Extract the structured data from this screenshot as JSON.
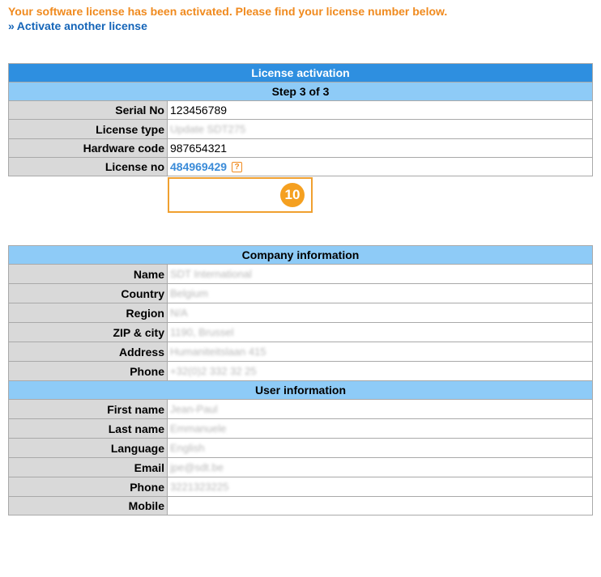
{
  "message": {
    "success": "Your software license has been activated. Please find your license number below.",
    "link_prefix": "»",
    "link_label": "Activate another license"
  },
  "license": {
    "title": "License activation",
    "step": "Step 3 of 3",
    "rows": [
      {
        "label": "Serial No",
        "value": "123456789"
      },
      {
        "label": "License type",
        "value": "Update SDT275"
      },
      {
        "label": "Hardware code",
        "value": "987654321"
      },
      {
        "label": "License no",
        "value": "484969429"
      }
    ],
    "help_icon": "?",
    "callout_number": "10"
  },
  "company": {
    "header": "Company information",
    "rows": [
      {
        "label": "Name",
        "value": "SDT International"
      },
      {
        "label": "Country",
        "value": "Belgium"
      },
      {
        "label": "Region",
        "value": "N/A"
      },
      {
        "label": "ZIP & city",
        "value": "1190, Brussel"
      },
      {
        "label": "Address",
        "value": "Humaniteitslaan 415"
      },
      {
        "label": "Phone",
        "value": "+32(0)2 332 32 25"
      }
    ]
  },
  "user": {
    "header": "User information",
    "rows": [
      {
        "label": "First name",
        "value": "Jean-Paul"
      },
      {
        "label": "Last name",
        "value": "Emmanuele"
      },
      {
        "label": "Language",
        "value": "English"
      },
      {
        "label": "Email",
        "value": "jpe@sdt.be"
      },
      {
        "label": "Phone",
        "value": "3221323225"
      },
      {
        "label": "Mobile",
        "value": ""
      }
    ]
  },
  "colors": {
    "accent_orange": "#f08a1e",
    "title_blue": "#2e8fe0",
    "section_blue": "#8ecbf7",
    "label_grey": "#d9d9d9",
    "link_blue": "#1565b8"
  }
}
